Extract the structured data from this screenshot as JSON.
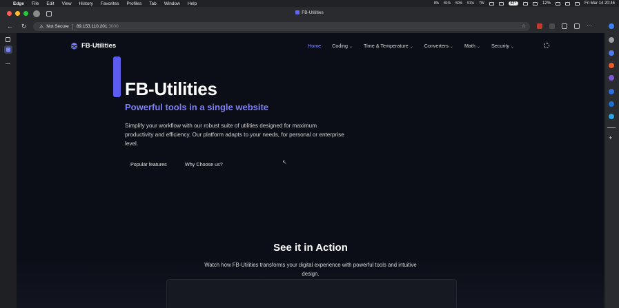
{
  "menubar": {
    "app_name": "Edge",
    "menus": [
      "File",
      "Edit",
      "View",
      "History",
      "Favorites",
      "Profiles",
      "Tab",
      "Window",
      "Help"
    ],
    "stats": [
      "8%",
      "81%",
      "50%",
      "51%",
      "7W"
    ],
    "temperature": "57°",
    "battery": "12%",
    "datetime": "Fri Mar 14  20:46"
  },
  "browser": {
    "tab_title": "FB-Utilities",
    "address": {
      "security_label": "Not Secure",
      "host": "89.153.110.201",
      "port": ":3000"
    }
  },
  "site": {
    "brand": "FB-Utilities",
    "nav": [
      {
        "label": "Home",
        "active": true,
        "dropdown": false
      },
      {
        "label": "Coding",
        "active": false,
        "dropdown": true
      },
      {
        "label": "Time & Temperature",
        "active": false,
        "dropdown": true
      },
      {
        "label": "Converters",
        "active": false,
        "dropdown": true
      },
      {
        "label": "Math",
        "active": false,
        "dropdown": true
      },
      {
        "label": "Security",
        "active": false,
        "dropdown": true
      }
    ],
    "hero": {
      "title": "FB-Utilities",
      "subtitle": "Powerful tools in a single website",
      "description": "Simplify your workflow with our robust suite of utilities designed for maximum productivity and efficiency. Our platform adapts to your needs, for personal or enterprise level.",
      "buttons": [
        "Popular features",
        "Why Choose us?"
      ]
    },
    "action": {
      "title": "See it in Action",
      "description": "Watch how FB-Utilities transforms your digital experience with powerful tools and intuitive design."
    }
  },
  "colors": {
    "accent": "#5b5bf0",
    "subtitle": "#7c7ff7",
    "page_bg": "#0b0d17"
  }
}
